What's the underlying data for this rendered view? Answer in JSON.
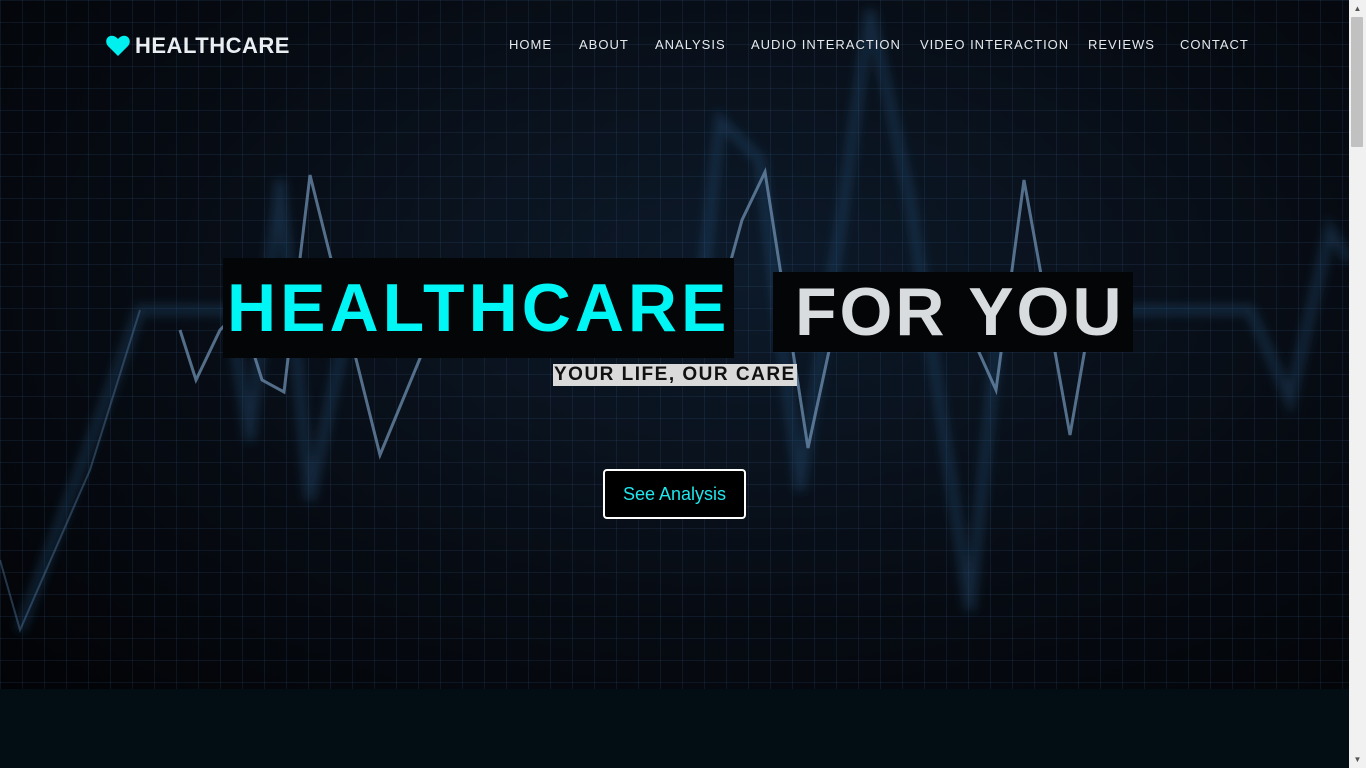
{
  "brand": {
    "name": "HEALTHCARE",
    "icon": "heart-icon",
    "color": "#00f0f0"
  },
  "nav": {
    "items": [
      {
        "label": "HOME"
      },
      {
        "label": "ABOUT"
      },
      {
        "label": "ANALYSIS"
      },
      {
        "label": "AUDIO INTERACTION"
      },
      {
        "label": "VIDEO INTERACTION"
      },
      {
        "label": "REVIEWS"
      },
      {
        "label": "CONTACT"
      }
    ]
  },
  "hero": {
    "title_highlight": "HEALTHCARE",
    "title_rest": "FOR YOU",
    "subtitle": "YOUR LIFE, OUR CARE",
    "cta_label": "See Analysis",
    "accent_color": "#00f5f5",
    "background": "ekg-heartbeat-grid"
  },
  "scrollbar": {
    "up_icon": "scroll-up-icon",
    "down_icon": "scroll-down-icon"
  }
}
